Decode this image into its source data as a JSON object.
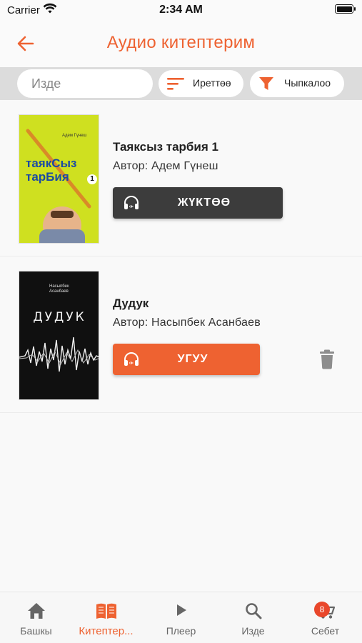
{
  "status_bar": {
    "carrier": "Carrier",
    "time": "2:34 AM"
  },
  "header": {
    "title": "Аудио китептерим",
    "back_icon": "arrow-left-icon"
  },
  "toolbar": {
    "search_placeholder": "Изде",
    "sort_label": "Иреттөө",
    "filter_label": "Чыпкалоо"
  },
  "books": [
    {
      "title": "Таяксыз тарбия 1",
      "author": "Автор: Адем Гүнеш",
      "action_label": "ЖҮКТӨӨ",
      "cover": {
        "author_line": "Адем Гүнеш",
        "line1": "таякСыз",
        "line2": "тарБия",
        "volume": "1"
      }
    },
    {
      "title": "Дудук",
      "author": "Автор: Насыпбек Асанбаев",
      "action_label": "УГУУ",
      "cover": {
        "author_line1": "Насыпбек",
        "author_line2": "Асанбаев",
        "title": "ДУДУК"
      }
    }
  ],
  "tabs": [
    {
      "label": "Башкы",
      "icon": "home-icon"
    },
    {
      "label": "Китептер...",
      "icon": "book-icon"
    },
    {
      "label": "Плеер",
      "icon": "play-icon"
    },
    {
      "label": "Изде",
      "icon": "search-icon"
    },
    {
      "label": "Себет",
      "icon": "cart-icon"
    }
  ],
  "cart_badge": "8",
  "colors": {
    "accent": "#ee6231",
    "dark_button": "#3c3c3c",
    "badge": "#e9472b"
  }
}
